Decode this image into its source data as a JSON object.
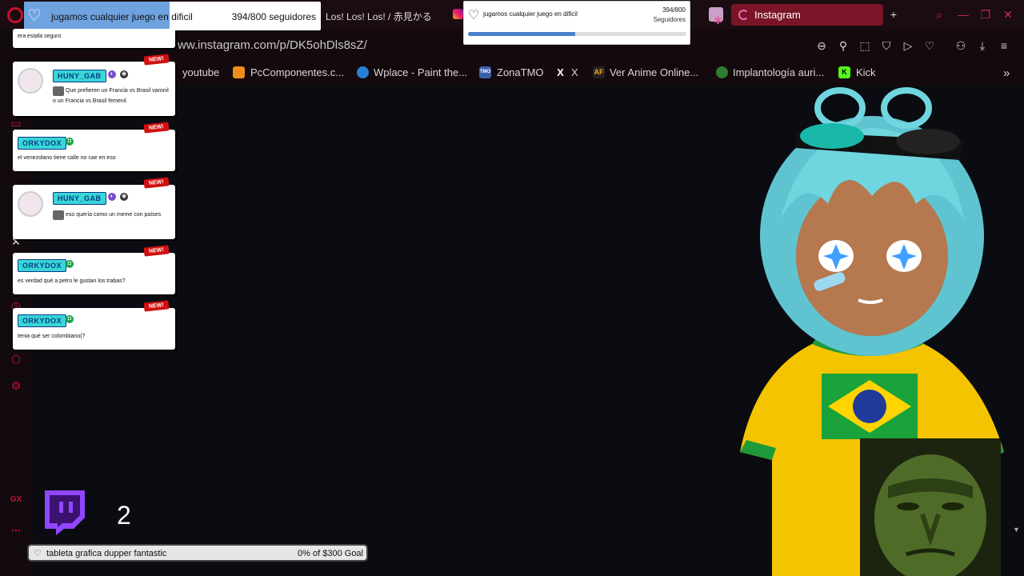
{
  "browser": {
    "tabs": [
      {
        "label": "Los! Los! Los! / 赤見かる"
      },
      {
        "label": "Instagram",
        "active": true
      }
    ],
    "url": "ww.instagram.com/p/DK5ohDls8sZ/",
    "bookmarks": [
      {
        "label": "youtube"
      },
      {
        "label": "PcComponentes.c..."
      },
      {
        "label": "Wplace - Paint the..."
      },
      {
        "label": "ZonaTMO"
      },
      {
        "label": "X"
      },
      {
        "label": "Ver Anime Online..."
      },
      {
        "label": "Implantología auri..."
      },
      {
        "label": "Kick"
      }
    ],
    "bookmark_icons": {
      "zonatmo": "TMO",
      "x": "X",
      "anime": "AF"
    },
    "sidebar_labels": {
      "gx": "GX",
      "more": "..."
    },
    "colors": {
      "accent": "#c8102e",
      "active_tab": "#7a1528"
    }
  },
  "follower_goal_large": {
    "title": "jugamos cualquier juego en dificil",
    "count": "394/800 seguidores",
    "progress": 0.49
  },
  "follower_goal_small": {
    "title": "jugamos cualquier juego en dificil",
    "count": "394/800",
    "sub": "Seguidores",
    "progress": 0.49
  },
  "chat": {
    "messages": [
      {
        "text": "era estafa seguro"
      },
      {
        "user": "HUNY_GAB",
        "text": "Que prefieren un Francia vs Brasil varonil o un Francia vs Brasil femenil",
        "new": "NEW!"
      },
      {
        "user": "ORKYDOX",
        "text": "el venezolano tiene calle no cae en eso",
        "new": "NEW!"
      },
      {
        "user": "HUNY_GAB",
        "text": "eso quería como un meme con países",
        "new": "NEW!"
      },
      {
        "user": "ORKYDOX",
        "text": "es verdad qué a petro le gustan los trabas?",
        "new": "NEW!"
      },
      {
        "user": "ORKYDOX",
        "text": "tenia qué ser colombiano(?",
        "new": "NEW!"
      }
    ]
  },
  "stream": {
    "counter": "2",
    "goal": {
      "label": "tableta grafica dupper fantastic",
      "amount": "0% of $300 Goal",
      "progress": 0
    }
  }
}
